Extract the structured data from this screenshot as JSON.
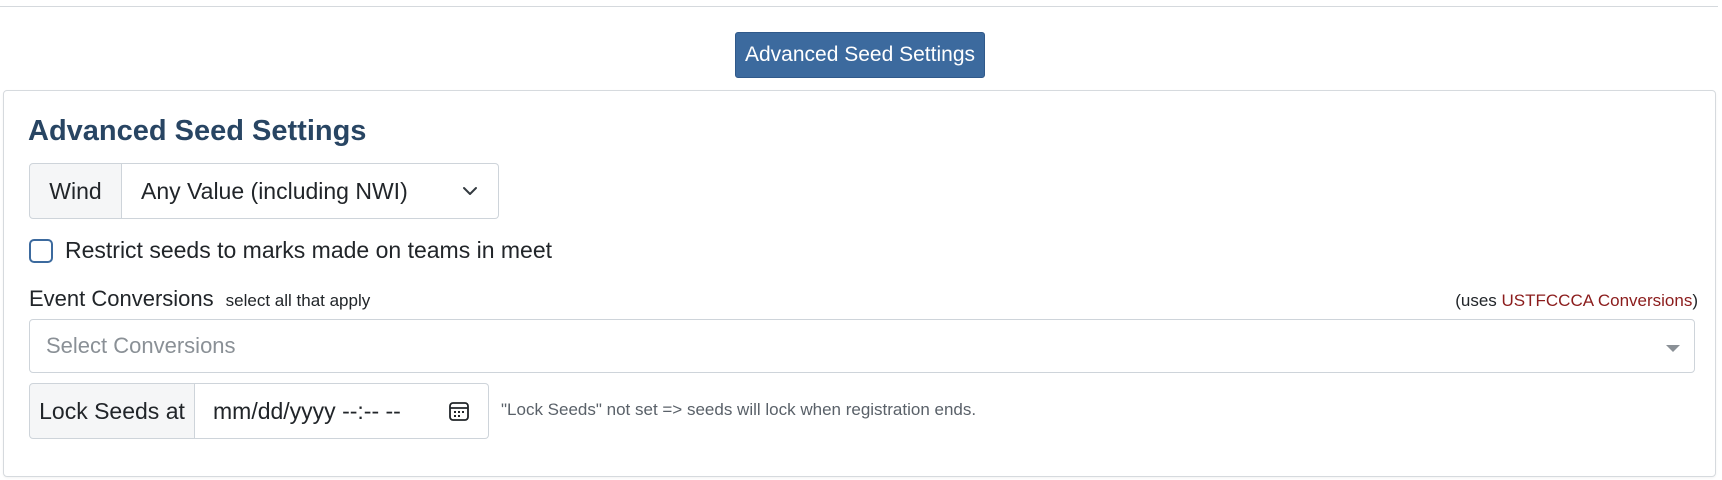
{
  "toggle_button": {
    "label": "Advanced Seed Settings"
  },
  "card": {
    "title": "Advanced Seed Settings",
    "wind": {
      "label": "Wind",
      "selected": "Any Value (including NWI)"
    },
    "restrict": {
      "label": "Restrict seeds to marks made on teams in meet",
      "checked": false
    },
    "conversions": {
      "label": "Event Conversions",
      "hint": "select all that apply",
      "uses_prefix": "(uses ",
      "uses_link": "USTFCCCA Conversions",
      "uses_suffix": ")",
      "placeholder": "Select Conversions"
    },
    "lock": {
      "label": "Lock Seeds at",
      "value": "mm/dd/yyyy --:-- --",
      "note": "\"Lock Seeds\" not set => seeds will lock when registration ends."
    }
  },
  "icons": {
    "select_chevron": "chevron-down-icon",
    "dropdown_caret": "caret-down-icon",
    "calendar": "calendar-icon"
  },
  "colors": {
    "primary": "#3c6a9e",
    "title": "#284563",
    "link": "#8b1c1c"
  }
}
